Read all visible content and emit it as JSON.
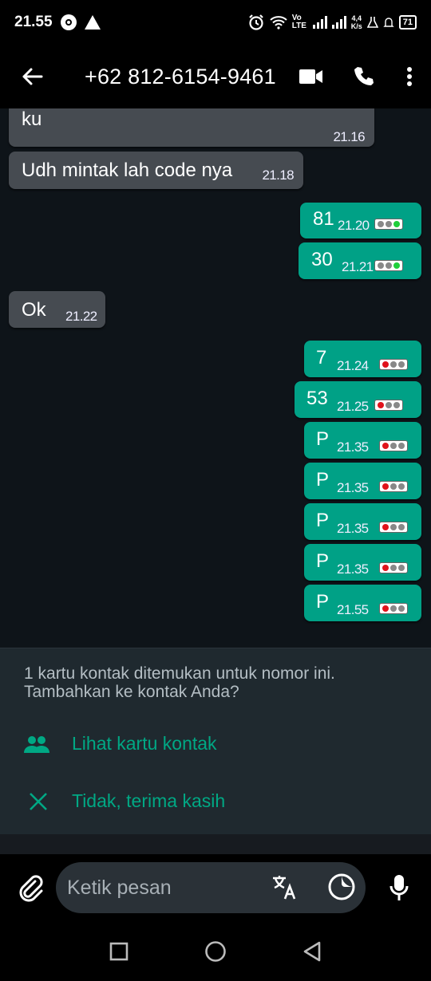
{
  "status_bar": {
    "time": "21.55",
    "net_speed": "4,4",
    "net_unit": "K/s",
    "network_type": "Vo LTE",
    "battery": "71"
  },
  "header": {
    "title": "+62 812-6154-9461"
  },
  "messages": [
    {
      "dir": "in",
      "text": "bentar dulu akan ku siri ss nick kawan ku",
      "time": "21.16",
      "partial": true
    },
    {
      "dir": "in",
      "text": "Udh mintak lah code nya",
      "time": "21.18"
    },
    {
      "dir": "out",
      "text": "81",
      "time": "21.20",
      "status_color": "#1fcf3b"
    },
    {
      "dir": "out",
      "text": "30",
      "time": "21.21",
      "status_color": "#1fcf3b"
    },
    {
      "dir": "in",
      "text": "Ok",
      "time": "21.22"
    },
    {
      "dir": "out",
      "text": "7",
      "time": "21.24",
      "status_color": "#e0121b"
    },
    {
      "dir": "out",
      "text": "53",
      "time": "21.25",
      "status_color": "#e0121b"
    },
    {
      "dir": "out",
      "text": "P",
      "time": "21.35",
      "status_color": "#e0121b"
    },
    {
      "dir": "out",
      "text": "P",
      "time": "21.35",
      "status_color": "#e0121b"
    },
    {
      "dir": "out",
      "text": "P",
      "time": "21.35",
      "status_color": "#e0121b"
    },
    {
      "dir": "out",
      "text": "P",
      "time": "21.35",
      "status_color": "#e0121b"
    },
    {
      "dir": "out",
      "text": "P",
      "time": "21.55",
      "status_color": "#e0121b"
    }
  ],
  "contact_card": {
    "message_line1": "1 kartu kontak ditemukan untuk nomor ini.",
    "message_line2": "Tambahkan ke kontak Anda?",
    "view_label": "Lihat kartu kontak",
    "dismiss_label": "Tidak, terima kasih"
  },
  "composer": {
    "placeholder": "Ketik pesan"
  },
  "colors": {
    "accent": "#00a884",
    "outgoing_bubble": "#00a186",
    "incoming_bubble": "#464b51"
  }
}
